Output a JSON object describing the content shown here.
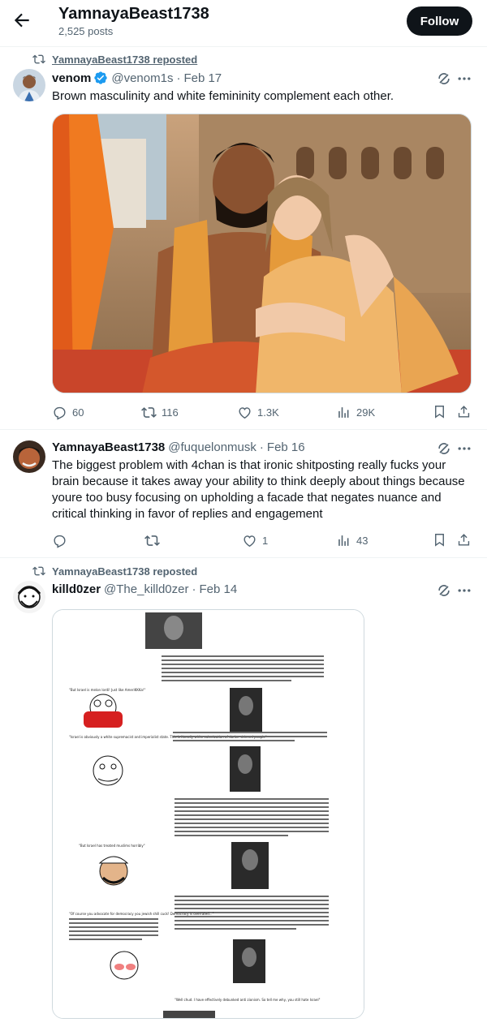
{
  "header": {
    "title": "YamnayaBeast1738",
    "posts": "2,525 posts",
    "follow_label": "Follow"
  },
  "tweets": [
    {
      "repost_label": "YamnayaBeast1738 reposted",
      "display_name": "venom",
      "handle": "@venom1s",
      "date": "Feb 17",
      "text": "Brown masculinity and white femininity complement each other.",
      "replies": "60",
      "reposts": "116",
      "likes": "1.3K",
      "views": "29K"
    },
    {
      "display_name": "YamnayaBeast1738",
      "handle": "@fuquelonmusk",
      "date": "Feb 16",
      "text": "The biggest problem with 4chan is that ironic shitposting really fucks your brain because it takes away your ability to think deeply about things because youre too busy focusing on upholding a facade that negates nuance and critical thinking in favor of replies and engagement",
      "replies": "",
      "reposts": "",
      "likes": "1",
      "views": "43"
    },
    {
      "repost_label": "YamnayaBeast1738 reposted",
      "display_name": "killd0zer",
      "handle": "@The_killd0zer",
      "date": "Feb 14"
    }
  ],
  "meme": {
    "q1": "\"But Israel is melon lordi! Just like AmeriKKKa!\"",
    "q2": "\"Israel is obviously a white supremacist and imperialist state. This is literally white colonization of darker skinned people\"",
    "q3": "\"But Israel has treated muslims horribly\"",
    "q4": "\"Of course you advocate for democracy you jewish shill cuck! Democracy is overrated...\"",
    "q5": "\"Well chud. I have effectively debunked anti zionism. So tell me why, you still hate Israel\""
  },
  "colors": {
    "text": "#0f1419",
    "secondary": "#536471",
    "verified": "#1d9bf0",
    "border": "#eff3f4"
  }
}
